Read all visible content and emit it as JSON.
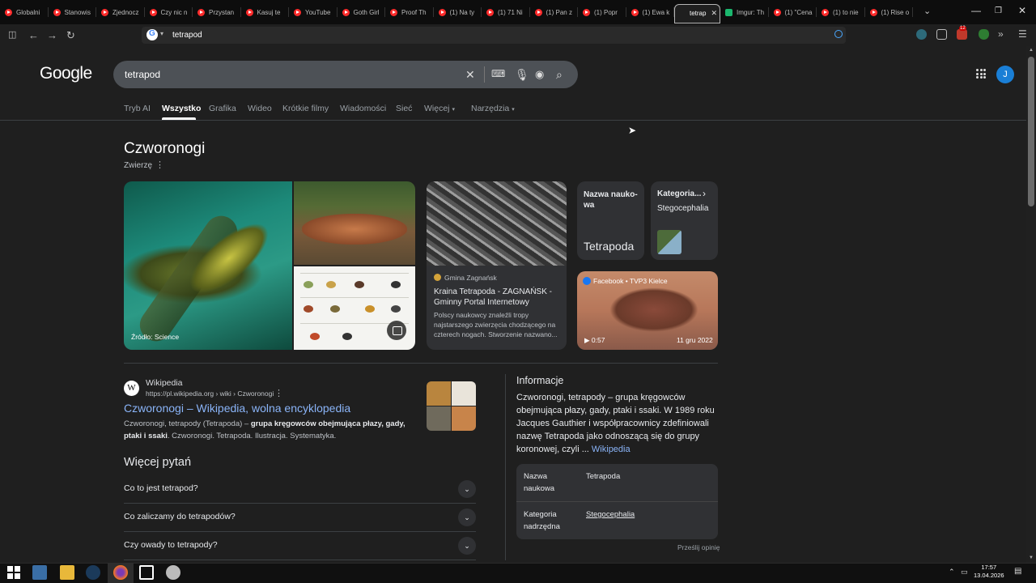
{
  "browser": {
    "tabs": [
      {
        "label": "Globalni",
        "icon": "youtube"
      },
      {
        "label": "Stanowis",
        "icon": "youtube"
      },
      {
        "label": "Zjednocz",
        "icon": "youtube"
      },
      {
        "label": "Czy nic n",
        "icon": "youtube"
      },
      {
        "label": "Przystan",
        "icon": "youtube"
      },
      {
        "label": "Kasuj te",
        "icon": "youtube"
      },
      {
        "label": "YouTube",
        "icon": "youtube"
      },
      {
        "label": "Goth Girl",
        "icon": "youtube"
      },
      {
        "label": "Proof Th",
        "icon": "youtube"
      },
      {
        "label": "(1) Na ty",
        "icon": "youtube"
      },
      {
        "label": "(1) 71 Ni",
        "icon": "youtube"
      },
      {
        "label": "(1) Pan z",
        "icon": "youtube"
      },
      {
        "label": "(1) Popr",
        "icon": "youtube"
      },
      {
        "label": "(1) Ewa k",
        "icon": "youtube"
      },
      {
        "label": "tetrap",
        "icon": "google",
        "active": true
      },
      {
        "label": "Imgur: Th",
        "icon": "imgur"
      },
      {
        "label": "(1) \"Cena",
        "icon": "youtube"
      },
      {
        "label": "(1) to nie",
        "icon": "youtube"
      },
      {
        "label": "(1) Rise o",
        "icon": "youtube"
      }
    ],
    "url": "tetrapod",
    "ext_badge": "12"
  },
  "google": {
    "logo": "Google",
    "query": "tetrapod",
    "tabs": [
      "Tryb AI",
      "Wszystko",
      "Grafika",
      "Wideo",
      "Krótkie filmy",
      "Wiadomości",
      "Sieć",
      "Więcej",
      "Narzędzia"
    ],
    "active_tab": "Wszystko",
    "avatar": "J"
  },
  "knowledge": {
    "title": "Czworonogi",
    "subtitle": "Zwierzę",
    "image_source": "Źródło: Science",
    "card": {
      "source": "Gmina Zagnańsk",
      "title": "Kraina Tetrapoda - ZAGNAŃSK - Gminny Portal Internetowy",
      "snippet": "Polscy naukowcy znaleźli tropy najstarszego zwierzęcia chodzącego na czterech nogach. Stworzenie nazwano..."
    },
    "sci_name": {
      "label": "Nazwa naukowa",
      "value": "Tetrapoda"
    },
    "category": {
      "label": "Kategoria...",
      "value": "Stegocephalia"
    },
    "video": {
      "source": "Facebook • TVP3 Kielce",
      "duration": "0:57",
      "date": "11 gru 2022"
    }
  },
  "result": {
    "site": "Wikipedia",
    "url": "https://pl.wikipedia.org › wiki › Czworonogi",
    "title": "Czworonogi – Wikipedia, wolna encyklopedia",
    "snippet_pre": "Czworonogi, tetrapody (Tetrapoda) – ",
    "snippet_bold": "grupa kręgowców obejmująca płazy, gady, ptaki i ssaki",
    "snippet_post": ". Czworonogi. Tetrapoda. Ilustracja. Systematyka."
  },
  "paa": {
    "title": "Więcej pytań",
    "questions": [
      "Co to jest tetrapod?",
      "Co zaliczamy do tetrapodów?",
      "Czy owady to tetrapody?"
    ]
  },
  "info": {
    "title": "Informacje",
    "description": "Czworonogi, tetrapody – grupa kręgowców obejmująca płazy, gady, ptaki i ssaki. W 1989 roku Jacques Gauthier i współpracownicy zdefiniowali nazwę Tetrapoda jako odnoszącą się do grupy koronowej, czyli ... ",
    "description_link": "Wikipedia",
    "rows": [
      {
        "key": "Nazwa naukowa",
        "value": "Tetrapoda",
        "link": false
      },
      {
        "key": "Kategoria nadrzędna",
        "value": "Stegocephalia",
        "link": true
      }
    ],
    "feedback": "Prześlij opinię"
  },
  "taskbar": {
    "time": "17:57",
    "date": "13.04.2026"
  }
}
